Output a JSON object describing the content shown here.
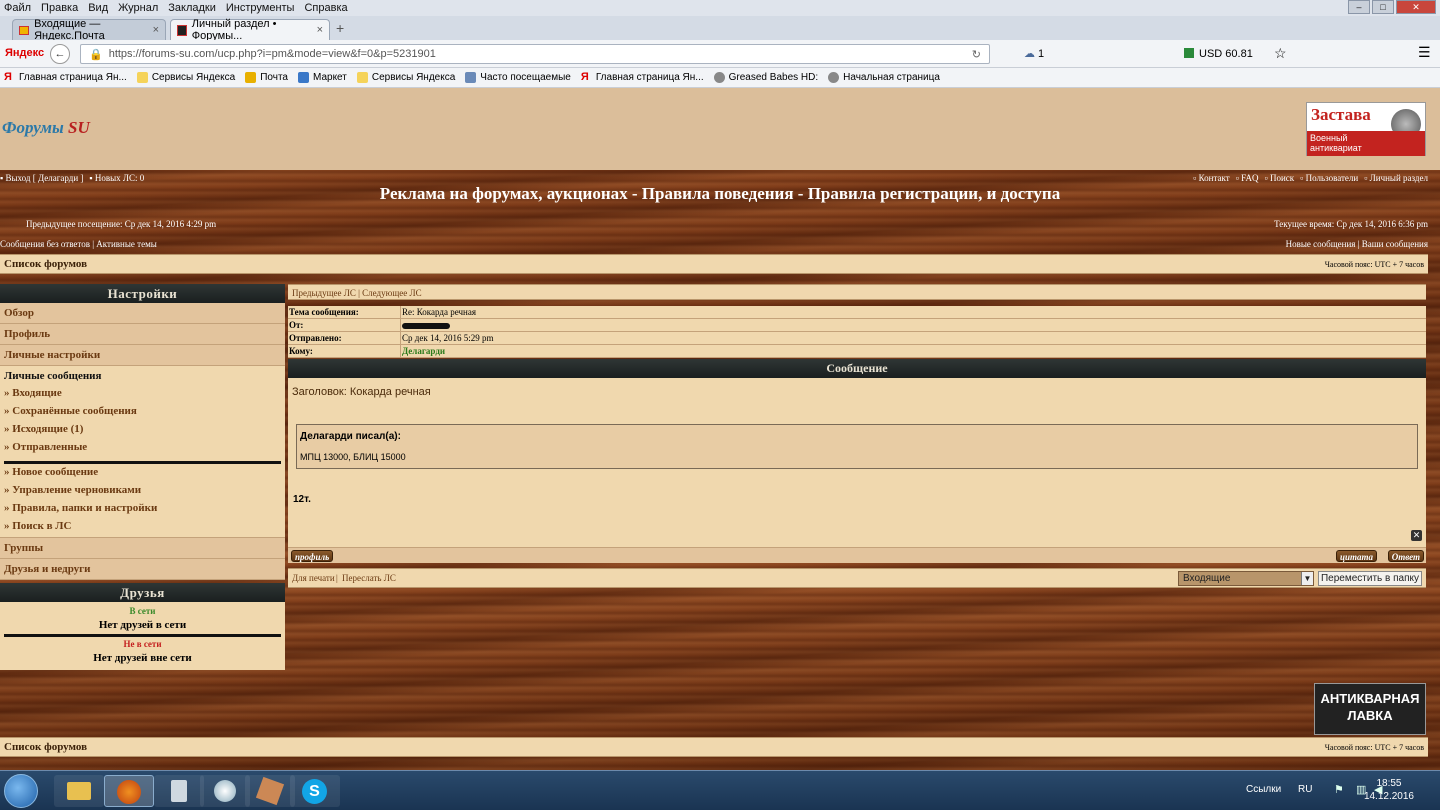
{
  "browser": {
    "menu": [
      "Файл",
      "Правка",
      "Вид",
      "Журнал",
      "Закладки",
      "Инструменты",
      "Справка"
    ],
    "tabs": [
      {
        "label": "Входящие — Яндекс.Почта"
      },
      {
        "label": "Личный раздел • Форумы..."
      }
    ],
    "yandex_label": "Яндекс",
    "url": "https://forums-su.com/ucp.php?i=pm&mode=view&f=0&p=5231901",
    "weather_count": "1",
    "currency": "USD 60.81",
    "bookmarks": [
      "Главная страница Ян...",
      "Сервисы Яндекса",
      "Почта",
      "Маркет",
      "Сервисы Яндекса",
      "Часто посещаемые",
      "Главная страница Ян...",
      "Greased Babes HD:",
      "Начальная страница"
    ]
  },
  "site": {
    "logo_main": "Форумы",
    "logo_su": "SU",
    "ad_title": "Застава",
    "ad_subtitle_1": "Военный",
    "ad_subtitle_2": "антиквариат",
    "logout": "Выход [ Делагарди ]",
    "new_pm": "Новых ЛС: 0",
    "top_links": [
      "Контакт",
      "FAQ",
      "Поиск",
      "Пользователи",
      "Личный раздел"
    ],
    "banner": "Реклама на форумах, аукционах - Правила поведения - Правила регистрации, и доступа",
    "last_visit": "Предыдущее посещение: Ср дек 14, 2016 4:29 pm",
    "current_time": "Текущее время: Ср дек 14, 2016 6:36 pm",
    "noreply": "Сообщения без ответов",
    "active": "Активные темы",
    "newposts": "Новые сообщения",
    "yourposts": "Ваши сообщения",
    "forum_list": "Список форумов",
    "timezone": "Часовой пояс: UTC + 7 часов",
    "bottom_ad_1": "АНТИКВАРНАЯ",
    "bottom_ad_2": "ЛАВКА"
  },
  "sidebar": {
    "settings_title": "Настройки",
    "overview": "Обзор",
    "profile": "Профиль",
    "personal_settings": "Личные настройки",
    "pm_title": "Личные сообщения",
    "pm_items": [
      "» Входящие",
      "» Сохранённые сообщения",
      "» Исходящие (1)",
      "» Отправленные"
    ],
    "pm_actions": [
      "» Новое сообщение",
      "» Управление черновиками",
      "» Правила, папки и настройки",
      "» Поиск в ЛС"
    ],
    "groups": "Группы",
    "friends_foes": "Друзья и недруги",
    "friends_title": "Друзья",
    "online_label": "В сети",
    "online_none": "Нет друзей в сети",
    "offline_label": "Не в сети",
    "offline_none": "Нет друзей вне сети"
  },
  "message": {
    "prev": "Предыдущее ЛС",
    "next": "Следующее ЛС",
    "subject_key": "Тема сообщения:",
    "subject_val": "Re: Кокарда речная",
    "from_key": "От:",
    "sent_key": "Отправлено:",
    "sent_val": "Ср дек 14, 2016 5:29 pm",
    "to_key": "Кому:",
    "to_val": "Делагарди",
    "section_title": "Сообщение",
    "heading": "Заголовок: Кокарда речная",
    "quote_author": "Делагарди писал(а):",
    "quote_text": "МПЦ 13000, БЛИЦ 15000",
    "body": "12т.",
    "btn_profile": "профиль",
    "btn_quote": "цитата",
    "btn_reply": "Ответ",
    "print": "Для печати",
    "forward": "Переслать ЛС",
    "folder_selected": "Входящие",
    "move_button": "Переместить в папку"
  },
  "taskbar": {
    "links": "Ссылки",
    "lang": "RU",
    "time": "18:55",
    "date": "14.12.2016"
  }
}
